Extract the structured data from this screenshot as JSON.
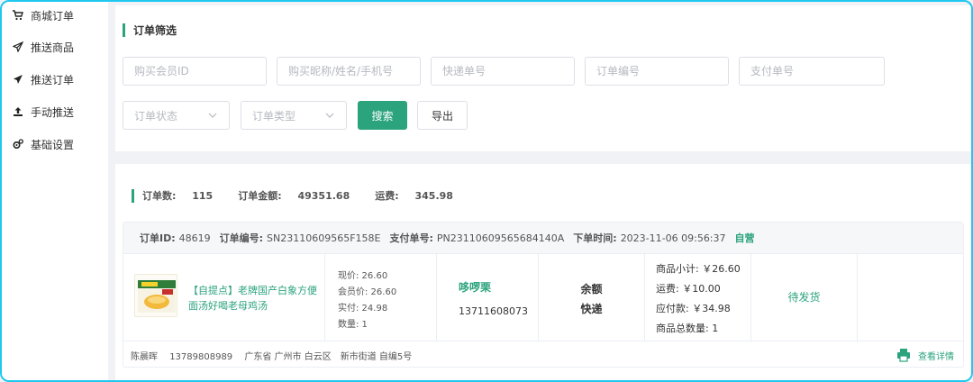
{
  "sidebar": {
    "items": [
      {
        "label": "商城订单",
        "icon": "cart-icon"
      },
      {
        "label": "推送商品",
        "icon": "paper-plane-outline-icon"
      },
      {
        "label": "推送订单",
        "icon": "paper-plane-icon"
      },
      {
        "label": "手动推送",
        "icon": "upload-icon"
      },
      {
        "label": "基础设置",
        "icon": "gears-icon"
      }
    ]
  },
  "filter": {
    "title": "订单筛选",
    "member_id_placeholder": "购买会员ID",
    "buyer_placeholder": "购买昵称/姓名/手机号",
    "express_placeholder": "快递单号",
    "order_no_placeholder": "订单编号",
    "pay_no_placeholder": "支付单号",
    "status_placeholder": "订单状态",
    "type_placeholder": "订单类型",
    "search_label": "搜索",
    "export_label": "导出"
  },
  "summary": {
    "count_label": "订单数:",
    "count_value": "115",
    "amount_label": "订单金额:",
    "amount_value": "49351.68",
    "freight_label": "运费:",
    "freight_value": "345.98"
  },
  "order": {
    "id_label": "订单ID:",
    "id_value": "48619",
    "no_label": "订单编号:",
    "no_value": "SN23110609565F158E",
    "pay_label": "支付单号:",
    "pay_value": "PN23110609565684140A",
    "time_label": "下单时间:",
    "time_value": "2023-11-06 09:56:37",
    "tag": "自营",
    "goods_name": "【自提点】老牌国产白象方便面汤好喝老母鸡汤",
    "prices": {
      "current": "现价: 26.60",
      "member": "会员价: 26.60",
      "paid": "实付: 24.98",
      "qty": "数量: 1"
    },
    "customer_name": "哆啰栗",
    "customer_phone": "13711608073",
    "pay_method": "余额",
    "delivery": "快递",
    "amounts": {
      "subtotal": "商品小计: ￥26.60",
      "freight": "运费: ￥10.00",
      "payable": "应付款: ￥34.98",
      "count": "商品总数量: 1"
    },
    "status": "待发货",
    "address": {
      "name": "陈晨晖",
      "phone": "13789808989",
      "region": "广东省 广州市 白云区",
      "street": "新市街道 自编5号"
    },
    "detail_label": "查看详情"
  },
  "colors": {
    "accent": "#2ba37d",
    "frame": "#1ec8f0"
  }
}
